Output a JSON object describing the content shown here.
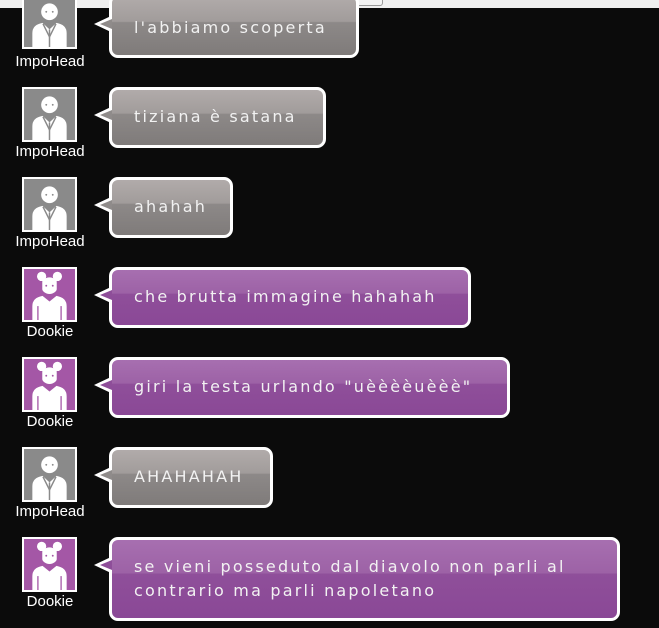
{
  "messages": [
    {
      "user": "ImpoHead",
      "text": "l'abbiamo scoperta",
      "style": "gray"
    },
    {
      "user": "ImpoHead",
      "text": "tiziana è satana",
      "style": "gray"
    },
    {
      "user": "ImpoHead",
      "text": "ahahah",
      "style": "gray"
    },
    {
      "user": "Dookie",
      "text": "che brutta immagine hahahah",
      "style": "purple"
    },
    {
      "user": "Dookie",
      "text": "giri la testa urlando \"uèèèèuèèè\"",
      "style": "purple"
    },
    {
      "user": "ImpoHead",
      "text": "AHAHAHAH",
      "style": "gray"
    },
    {
      "user": "Dookie",
      "text": "se vieni posseduto dal diavolo non parli al\ncontrario ma parli napoletano",
      "style": "purple"
    }
  ],
  "colors": {
    "gray_avatar": "#8a8a8a",
    "purple_avatar": "#a457a6",
    "gray_bubble": "#8d8988",
    "purple_bubble": "#8f4f9a",
    "background": "#0b0b0b"
  },
  "icons": {
    "male_avatar": "user-male-icon",
    "female_avatar": "user-female-icon"
  }
}
